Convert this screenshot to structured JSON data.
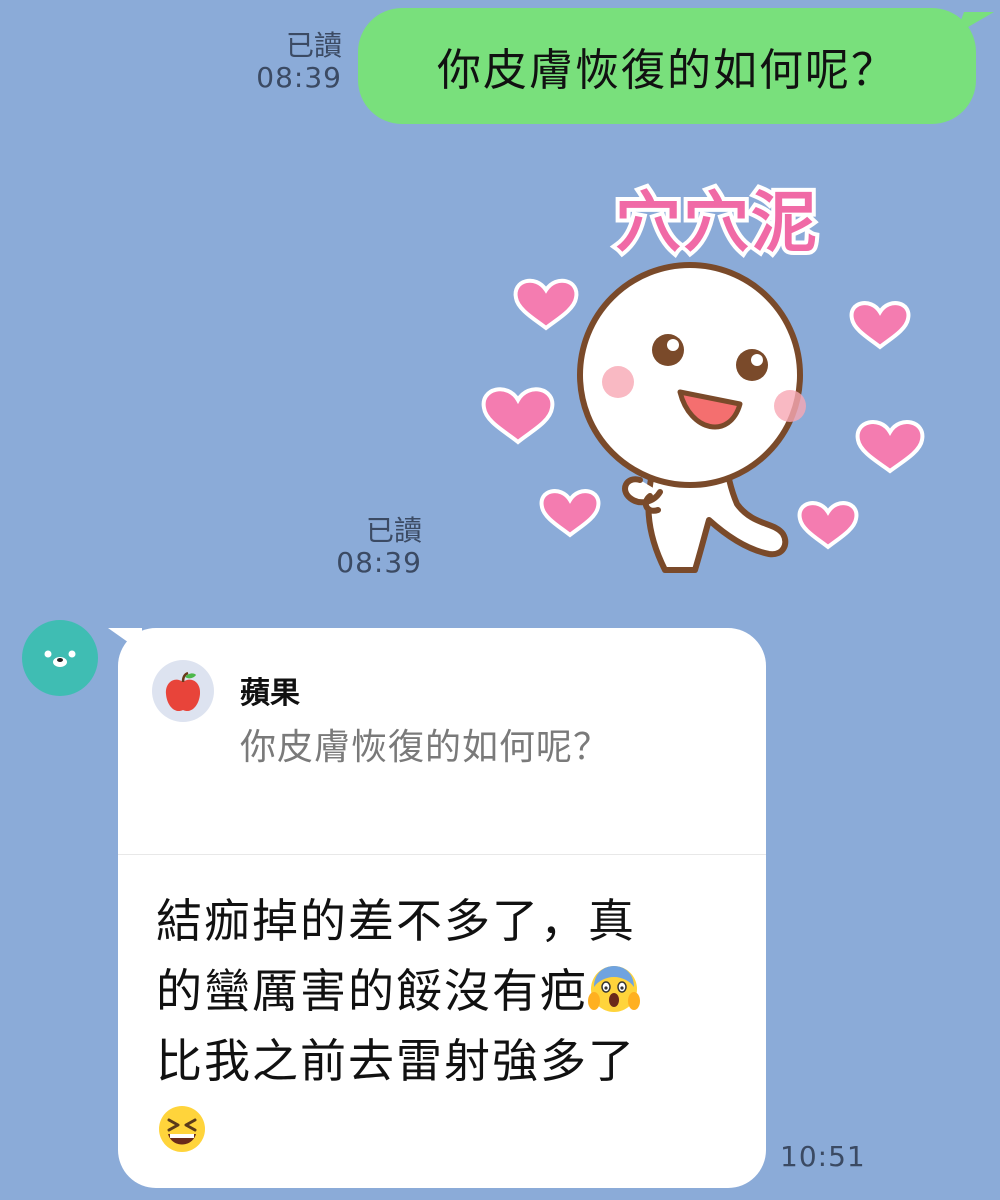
{
  "colors": {
    "background": "#8babd8",
    "outgoing_bubble": "#79e07c",
    "incoming_bubble": "#ffffff",
    "avatar": "#3fbdb3",
    "sticker_text": "#f06aa6",
    "heart": "#f47cb0"
  },
  "messages": {
    "outgoing_text": {
      "read_label": "已讀",
      "time": "08:39",
      "text": "你皮膚恢復的如何呢？"
    },
    "outgoing_sticker": {
      "read_label": "已讀",
      "time": "08:39",
      "sticker_caption": "穴穴泥",
      "icon": "smiling-character-hearts-sticker"
    },
    "incoming_reply": {
      "avatar_icon": "bear-avatar-icon",
      "quote": {
        "icon": "apple-icon",
        "name": "蘋果",
        "text": "你皮膚恢復的如何呢？"
      },
      "lines": [
        "結痂掉的差不多了，真",
        "的蠻厲害的餒沒有疤",
        "比我之前去雷射強多了"
      ],
      "emoji_1": "face-screaming-in-fear-emoji",
      "emoji_2": "grinning-squinting-face-emoji",
      "time": "10:51"
    }
  }
}
